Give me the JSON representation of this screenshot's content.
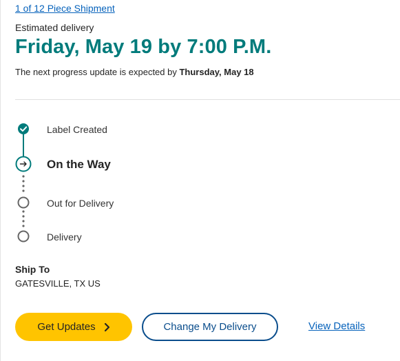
{
  "shipment": {
    "link_text": "1 of 12 Piece Shipment"
  },
  "delivery": {
    "estimated_label": "Estimated delivery",
    "estimated_date": "Friday, May 19 by 7:00 P.M.",
    "next_update_prefix": "The next progress update is expected by ",
    "next_update_date": "Thursday, May 18"
  },
  "progress": {
    "steps": [
      {
        "label": "Label Created",
        "status": "complete",
        "icon": "check-icon"
      },
      {
        "label": "On the Way",
        "status": "current",
        "icon": "arrow-right-icon"
      },
      {
        "label": "Out for Delivery",
        "status": "pending",
        "icon": "empty-circle-icon"
      },
      {
        "label": "Delivery",
        "status": "pending",
        "icon": "empty-circle-icon"
      }
    ]
  },
  "ship_to": {
    "label": "Ship To",
    "value": "GATESVILLE, TX US"
  },
  "actions": {
    "get_updates": "Get Updates",
    "change_delivery": "Change My Delivery",
    "view_details": "View Details"
  },
  "colors": {
    "accent_teal": "#007b7b",
    "link_blue": "#0662bb",
    "button_yellow": "#ffc400",
    "button_navy": "#0a4d8c",
    "pending_gray": "#666666"
  }
}
